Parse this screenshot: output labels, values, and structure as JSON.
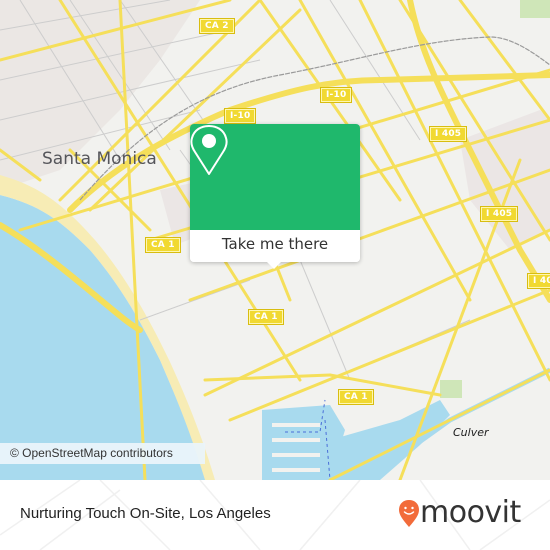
{
  "map": {
    "city_label": "Santa Monica",
    "town_label": "Culver",
    "shields": [
      {
        "id": "ca2",
        "label": "CA 2"
      },
      {
        "id": "i10-a",
        "label": "I-10"
      },
      {
        "id": "i10-b",
        "label": "I-10"
      },
      {
        "id": "i405-a",
        "label": "I 405"
      },
      {
        "id": "i405-b",
        "label": "I 405"
      },
      {
        "id": "i405-c",
        "label": "I 40"
      },
      {
        "id": "ca1-a",
        "label": "CA 1"
      },
      {
        "id": "ca1-b",
        "label": "CA 1"
      },
      {
        "id": "ca1-c",
        "label": "CA 1"
      }
    ],
    "colors": {
      "land": "#f2f2ef",
      "water": "#a8daee",
      "beach": "#f7ecb5",
      "road_major": "#f5df5a",
      "road_minor": "#c8c8c8",
      "park": "#cfe6b8",
      "urban": "#e9e4e2"
    },
    "attribution": "© OpenStreetMap contributors"
  },
  "popup": {
    "icon": "location-pin-icon",
    "button_label": "Take me there",
    "accent": "#1fb86c"
  },
  "footer": {
    "place_name": "Nurturing Touch On-Site, Los Angeles",
    "brand": "moovit",
    "brand_icon": "moovit-smile-pin-icon",
    "brand_color": "#f26b3a"
  }
}
